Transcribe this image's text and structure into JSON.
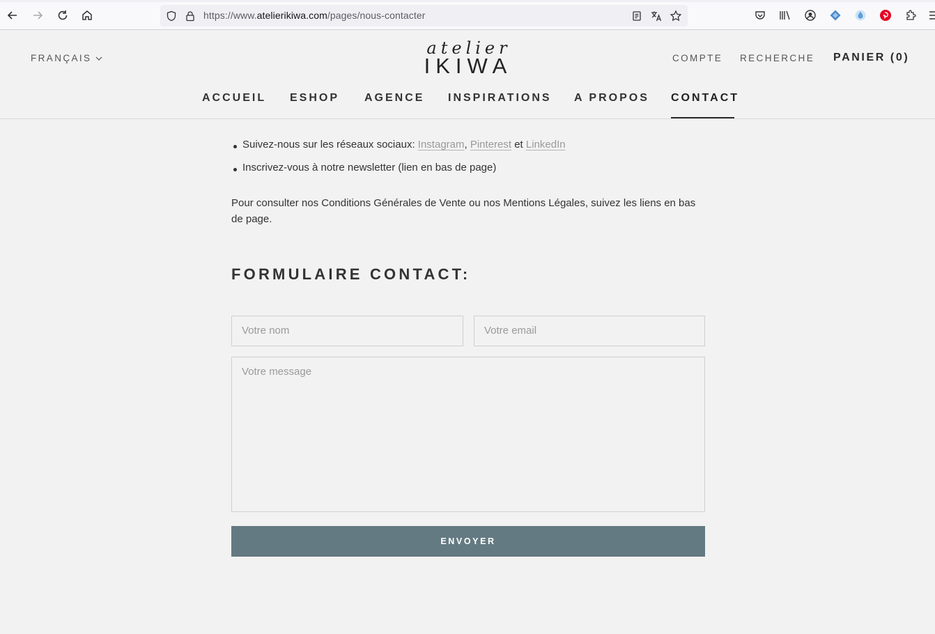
{
  "browser": {
    "url_prefix": "https://www.",
    "url_host": "atelierikiwa.com",
    "url_path": "/pages/nous-contacter"
  },
  "header": {
    "language": "FRANÇAIS",
    "logo_script": "atelier",
    "logo_caps": "IKIWA",
    "account": "COMPTE",
    "search": "RECHERCHE",
    "cart": "PANIER (0)"
  },
  "nav": {
    "items": [
      "ACCUEIL",
      "ESHOP",
      "AGENCE",
      "INSPIRATIONS",
      "A PROPOS",
      "CONTACT"
    ],
    "active": "CONTACT"
  },
  "content": {
    "bullet1_prefix": "Suivez-nous sur les réseaux sociaux: ",
    "link_instagram": "Instagram",
    "sep1": ", ",
    "link_pinterest": "Pinterest",
    "sep2": " et ",
    "link_linkedin": "LinkedIn",
    "bullet2": "Inscrivez-vous à notre newsletter (lien en bas de page)",
    "paragraph": "Pour consulter nos Conditions Générales de Vente ou nos Mentions Légales, suivez les liens en bas de page.",
    "form_title": "FORMULAIRE CONTACT:"
  },
  "form": {
    "name_placeholder": "Votre nom",
    "email_placeholder": "Votre email",
    "message_placeholder": "Votre message",
    "submit_label": "ENVOYER"
  },
  "colors": {
    "page_bg": "#f2f2f2",
    "button_bg": "#647a82",
    "text": "#2b2b2b",
    "link": "#9a9a9a"
  }
}
